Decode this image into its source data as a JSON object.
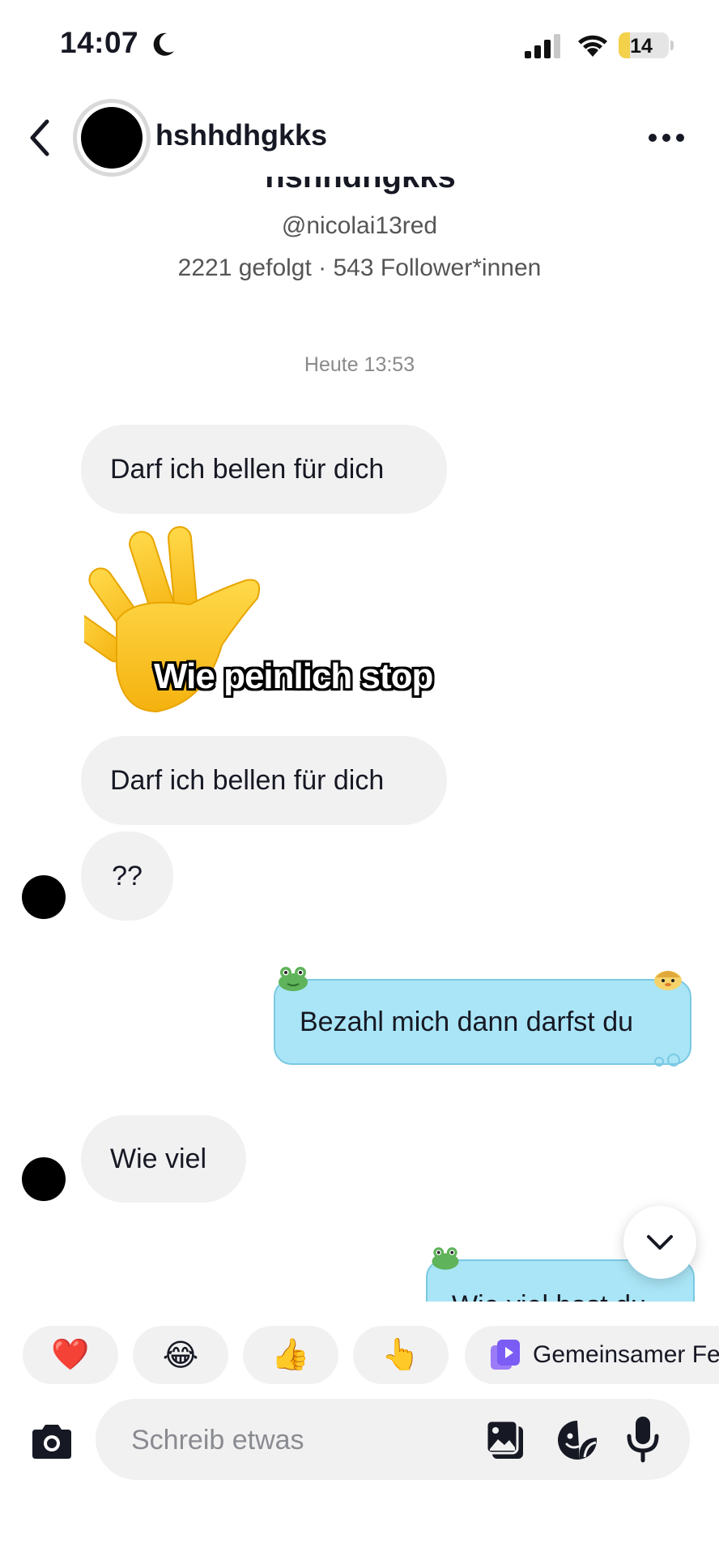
{
  "status_bar": {
    "time": "14:07",
    "battery": "14"
  },
  "header": {
    "username": "hshhdhgkks"
  },
  "profile": {
    "name": "hshhdhgkks",
    "handle": "@nicolai13red",
    "stats": "2221 gefolgt · 543 Follower*innen"
  },
  "conversation": {
    "date_divider": "Heute 13:53",
    "messages": [
      {
        "text": "Darf ich bellen für dich"
      },
      {
        "text": "Wie peinlich stop"
      },
      {
        "text": "Darf ich bellen für dich"
      },
      {
        "text": "??"
      },
      {
        "text": "Bezahl mich dann darfst du"
      },
      {
        "text": "Wie viel"
      },
      {
        "text": "Wie viel hast du"
      }
    ]
  },
  "quick_reactions": [
    {
      "emoji": "❤️",
      "icon": "heart"
    },
    {
      "emoji": "😂",
      "icon": "tears-of-joy"
    },
    {
      "emoji": "👍",
      "icon": "thumbs-up"
    },
    {
      "emoji": "👆",
      "icon": "pointing-hand"
    },
    {
      "label": "Gemeinsamer Fe",
      "icon": "play-stack-icon"
    }
  ],
  "composer": {
    "placeholder": "Schreib etwas"
  },
  "colors": {
    "outgoing_bubble": "#a9e5f6",
    "incoming_bubble": "#f1f1f2",
    "accent": "#7b5cf5"
  }
}
